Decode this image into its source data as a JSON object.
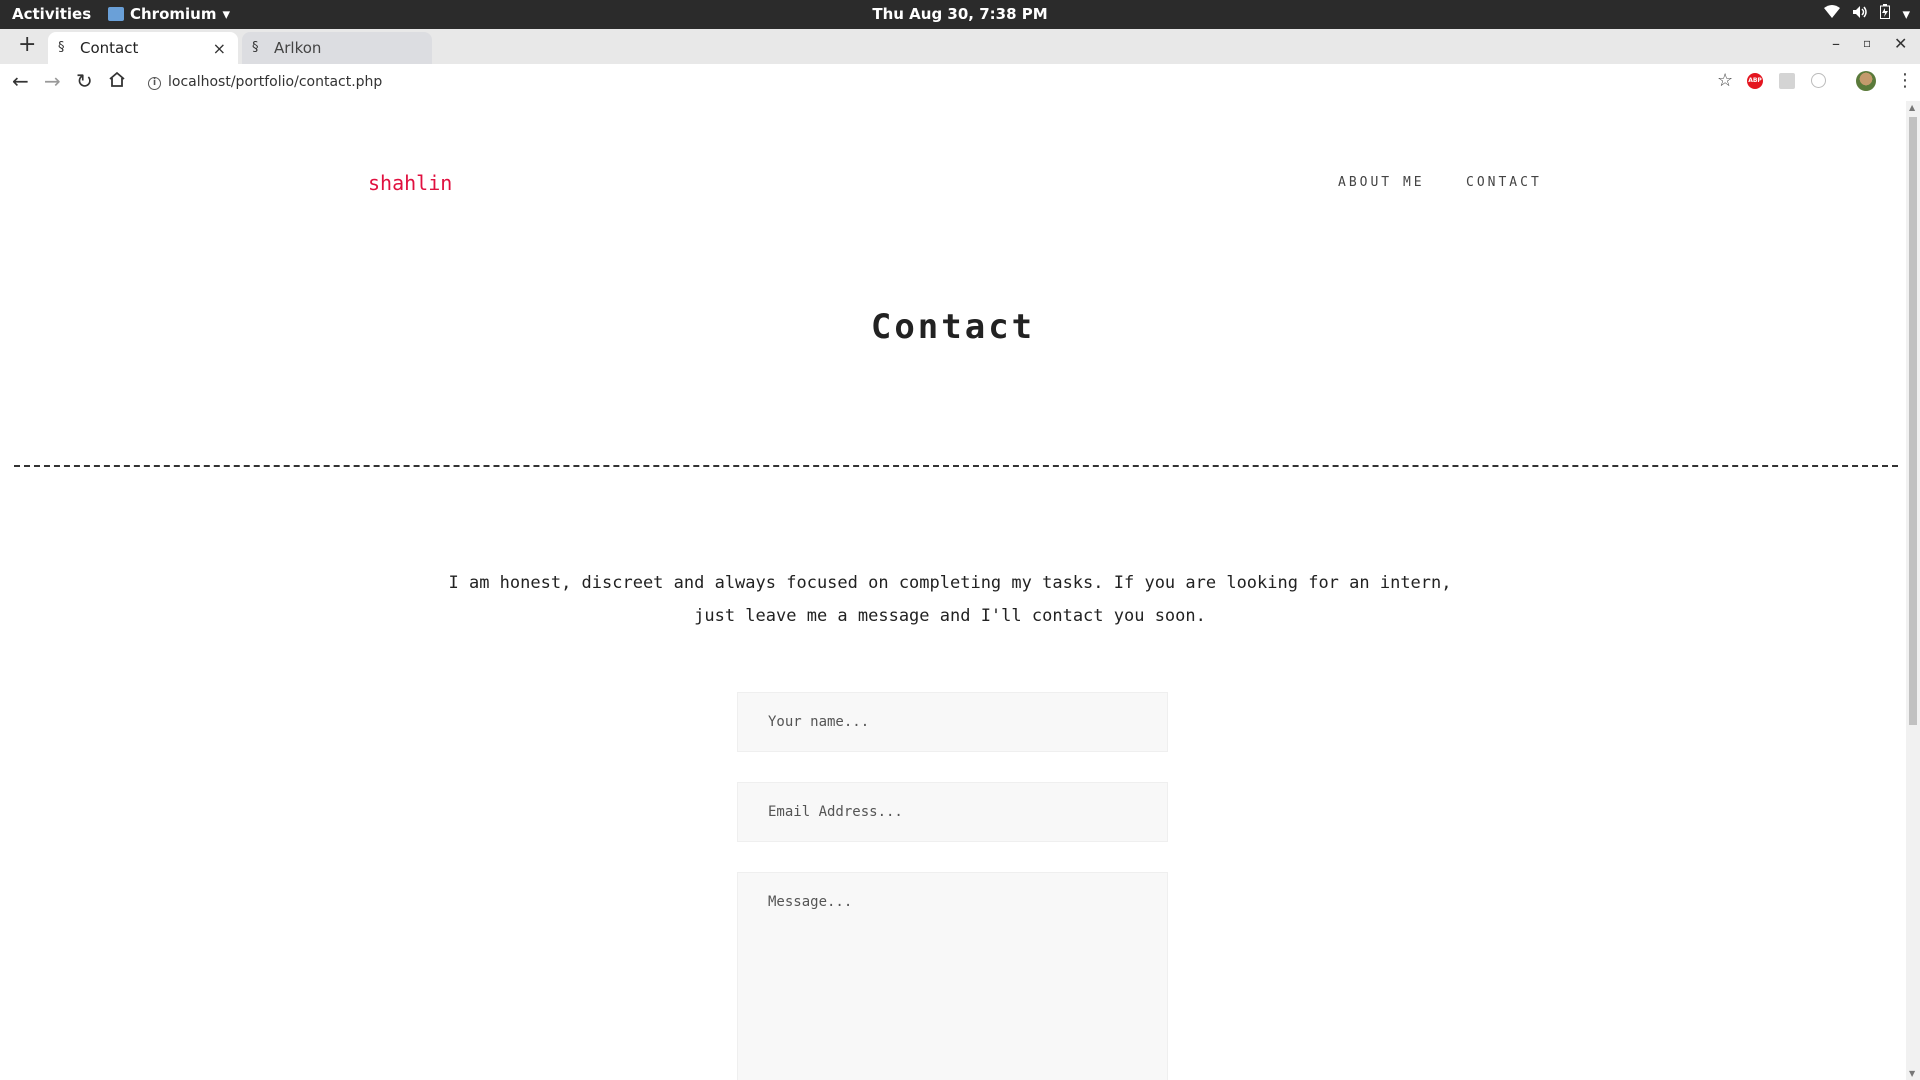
{
  "system": {
    "activities": "Activities",
    "app_name": "Chromium",
    "clock": "Thu Aug 30,  7:38 PM",
    "tray_icons": [
      "wifi-icon",
      "volume-icon",
      "battery-icon",
      "system-menu-icon"
    ]
  },
  "browser": {
    "tabs": [
      {
        "title": "Contact",
        "active": true
      },
      {
        "title": "Arlkon",
        "active": false
      }
    ],
    "url": "localhost/portfolio/contact.php",
    "extensions": [
      "bookmark-star-icon",
      "adblock-icon",
      "extension-icon",
      "extension-circle-icon",
      "profile-avatar",
      "menu-icon"
    ]
  },
  "site": {
    "brand": "shahlin",
    "nav": [
      "ABOUT ME",
      "CONTACT"
    ],
    "brand_color": "#e0103f",
    "page_title": "Contact",
    "intro_line1": "I am honest, discreet and always focused on completing my tasks. If you are looking for an intern,",
    "intro_line2": "just leave me a message and I'll contact you soon.",
    "form": {
      "name_placeholder": "Your name...",
      "email_placeholder": "Email Address...",
      "message_placeholder": "Message..."
    }
  }
}
